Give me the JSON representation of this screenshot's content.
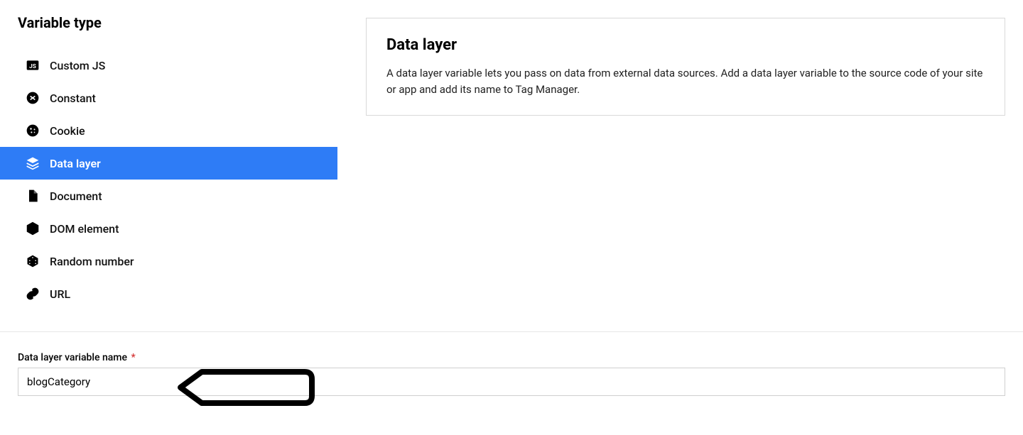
{
  "sidebar": {
    "title": "Variable type",
    "items": [
      {
        "label": "Custom JS"
      },
      {
        "label": "Constant"
      },
      {
        "label": "Cookie"
      },
      {
        "label": "Data layer"
      },
      {
        "label": "Document"
      },
      {
        "label": "DOM element"
      },
      {
        "label": "Random number"
      },
      {
        "label": "URL"
      }
    ]
  },
  "detail": {
    "title": "Data layer",
    "description": "A data layer variable lets you pass on data from external data sources. Add a data layer variable to the source code of your site or app and add its name to Tag Manager."
  },
  "form": {
    "label": "Data layer variable name",
    "required_mark": "*",
    "value": "blogCategory"
  }
}
